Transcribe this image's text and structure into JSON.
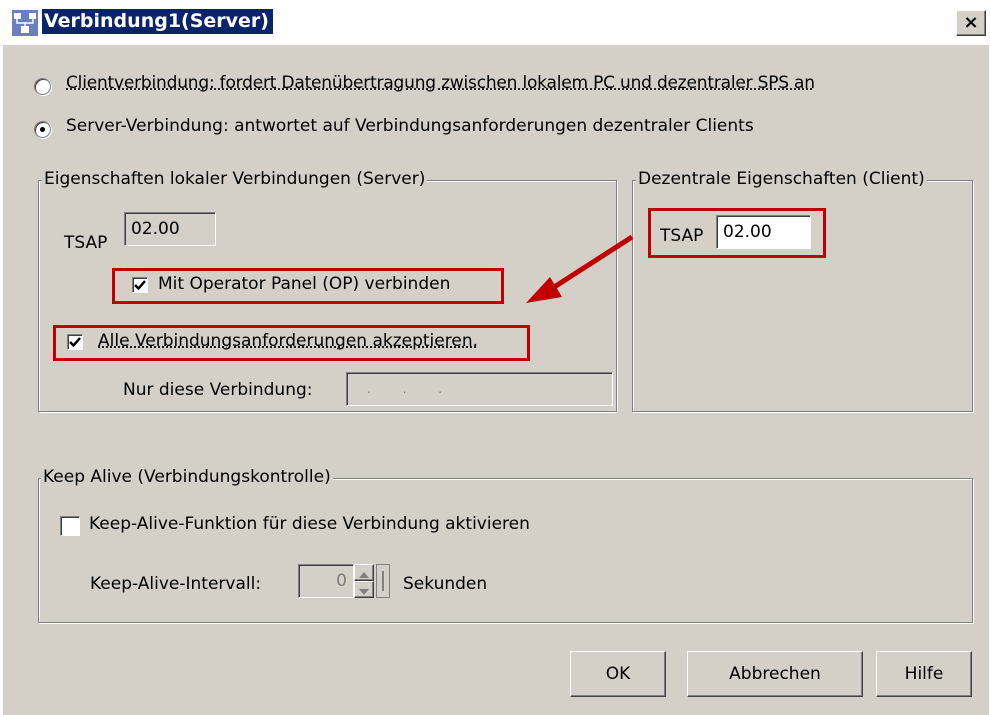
{
  "window": {
    "title": "Verbindung1(Server)",
    "close_glyph": "×"
  },
  "connection_mode": {
    "client_label": "Clientverbindung: fordert Datenübertragung zwischen lokalem PC und dezentraler SPS an",
    "server_label": "Server-Verbindung: antwortet auf Verbindungsanforderungen dezentraler Clients",
    "selected": "server"
  },
  "local_group": {
    "title": "Eigenschaften lokaler Verbindungen (Server)",
    "tsap_label": "TSAP",
    "tsap_value": "02.00",
    "op_panel_label": "Mit Operator Panel (OP) verbinden",
    "op_panel_checked": true,
    "accept_all_label": "Alle Verbindungsanforderungen akzeptieren.",
    "accept_all_checked": true,
    "only_this_label": "Nur diese Verbindung:",
    "only_this_value": ". . ."
  },
  "remote_group": {
    "title": "Dezentrale Eigenschaften (Client)",
    "tsap_label": "TSAP",
    "tsap_value": "02.00"
  },
  "keepalive_group": {
    "title": "Keep Alive (Verbindungskontrolle)",
    "enable_label": "Keep-Alive-Funktion für diese Verbindung aktivieren",
    "enable_checked": false,
    "interval_label": "Keep-Alive-Intervall:",
    "interval_value": "0",
    "unit_label": "Sekunden"
  },
  "buttons": {
    "ok": "OK",
    "cancel": "Abbrechen",
    "help": "Hilfe"
  },
  "colors": {
    "highlight_red": "#c00000",
    "dialog_bg": "#d4d0c8",
    "titlebar_bg": "#0a246a"
  },
  "icons": {
    "window": "network-connection-icon",
    "close": "close-icon",
    "annotation_arrow": "red-arrow-icon"
  }
}
